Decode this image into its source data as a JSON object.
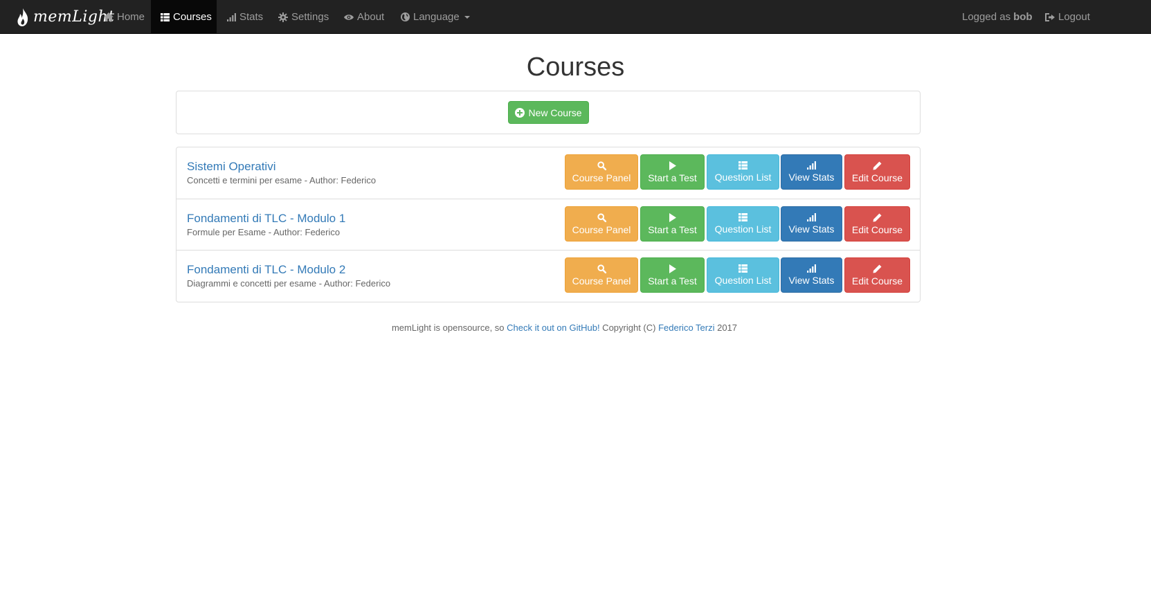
{
  "navbar": {
    "brand": "memLight",
    "items": [
      {
        "label": "Home",
        "icon": "home-icon"
      },
      {
        "label": "Courses",
        "icon": "table-icon",
        "active": true
      },
      {
        "label": "Stats",
        "icon": "signal-icon"
      },
      {
        "label": "Settings",
        "icon": "gear-icon"
      },
      {
        "label": "About",
        "icon": "eye-icon"
      },
      {
        "label": "Language",
        "icon": "globe-icon"
      }
    ],
    "logged_prefix": "Logged as",
    "username": "bob",
    "logout": "Logout"
  },
  "page": {
    "title": "Courses",
    "new_course_label": "New Course"
  },
  "buttons": {
    "course_panel": "Course Panel",
    "start_test": "Start a Test",
    "question_list": "Question List",
    "view_stats": "View Stats",
    "edit_course": "Edit Course"
  },
  "courses": [
    {
      "title": "Sistemi Operativi",
      "description": "Concetti e termini per esame - Author: Federico"
    },
    {
      "title": "Fondamenti di TLC - Modulo 1",
      "description": "Formule per Esame - Author: Federico"
    },
    {
      "title": "Fondamenti di TLC - Modulo 2",
      "description": "Diagrammi e concetti per esame - Author: Federico"
    }
  ],
  "footer": {
    "text1": "memLight is opensource, so ",
    "link1": "Check it out on GitHub!",
    "text2": " Copyright (C) ",
    "link2": "Federico Terzi",
    "text3": " 2017"
  },
  "colors": {
    "navbar_bg": "#222222",
    "primary": "#337ab7",
    "success": "#5cb85c",
    "warning": "#f0ad4e",
    "info": "#5bc0de",
    "danger": "#d9534f"
  }
}
